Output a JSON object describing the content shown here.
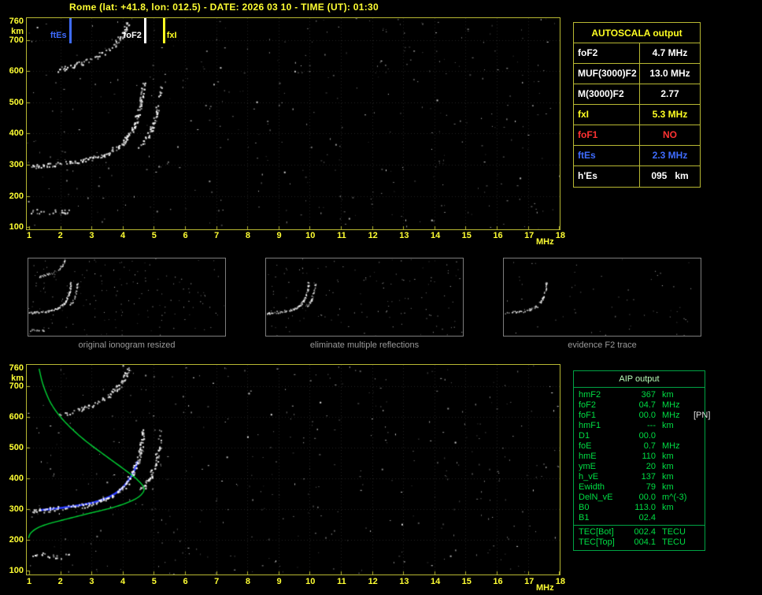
{
  "title": "Rome (lat: +41.8, lon: 012.5) - DATE: 2026 03 10 - TIME (UT): 01:30",
  "ionogram": {
    "y_labels": [
      "760",
      "700",
      "600",
      "500",
      "400",
      "300",
      "200",
      "100"
    ],
    "y_unit": "km",
    "x_labels": [
      "1",
      "2",
      "3",
      "4",
      "5",
      "6",
      "7",
      "8",
      "9",
      "10",
      "11",
      "12",
      "13",
      "14",
      "15",
      "16",
      "17",
      "18"
    ],
    "x_unit": "MHz",
    "legend": [
      {
        "label": "ftEs",
        "freq": 2.3,
        "color": "#3f6cff",
        "label_side": "left"
      },
      {
        "label": "foF2",
        "freq": 4.7,
        "color": "#ffffff",
        "label_side": "left"
      },
      {
        "label": "fxI",
        "freq": 5.3,
        "color": "#ffff22",
        "label_side": "right"
      }
    ]
  },
  "autoscala": {
    "title": "AUTOSCALA output",
    "rows": [
      {
        "label": "foF2",
        "value": "4.7 MHz",
        "color": "#ffffff"
      },
      {
        "label": "MUF(3000)F2",
        "value": "13.0 MHz",
        "color": "#ffffff"
      },
      {
        "label": "M(3000)F2",
        "value": "2.77",
        "color": "#ffffff"
      },
      {
        "label": "fxI",
        "value": "5.3 MHz",
        "color": "#ffff22"
      },
      {
        "label": "foF1",
        "value": "NO",
        "color": "#ff3232"
      },
      {
        "label": "ftEs",
        "value": "2.3 MHz",
        "color": "#3f6cff"
      },
      {
        "label": "h'Es",
        "value": "095   km",
        "color": "#ffffff"
      }
    ]
  },
  "thumbnails": [
    {
      "caption": "original ionogram resized"
    },
    {
      "caption": "eliminate multiple reflections"
    },
    {
      "caption": "evidence F2 trace"
    }
  ],
  "aip": {
    "title": "AIP output",
    "rows": [
      {
        "label": "hmF2",
        "value": "367",
        "unit": "km",
        "extra": ""
      },
      {
        "label": "foF2",
        "value": "04.7",
        "unit": "MHz",
        "extra": ""
      },
      {
        "label": "foF1",
        "value": "00.0",
        "unit": "MHz",
        "extra": "[PN]"
      },
      {
        "label": "hmF1",
        "value": "---",
        "unit": "km",
        "extra": ""
      },
      {
        "label": "D1",
        "value": "00.0",
        "unit": "",
        "extra": ""
      },
      {
        "label": "foE",
        "value": "0.7",
        "unit": "MHz",
        "extra": ""
      },
      {
        "label": "hmE",
        "value": "110",
        "unit": "km",
        "extra": ""
      },
      {
        "label": "ymE",
        "value": "20",
        "unit": "km",
        "extra": ""
      },
      {
        "label": "h_vE",
        "value": "137",
        "unit": "km",
        "extra": ""
      },
      {
        "label": "Ewidth",
        "value": "79",
        "unit": "km",
        "extra": ""
      },
      {
        "label": "DelN_vE",
        "value": "00.0",
        "unit": "m^(-3)",
        "extra": ""
      },
      {
        "label": "B0",
        "value": "113.0",
        "unit": "km",
        "extra": ""
      },
      {
        "label": "B1",
        "value": "02.4",
        "unit": "",
        "extra": ""
      }
    ],
    "tec_rows": [
      {
        "label": "TEC[Bot]",
        "value": "002.4",
        "unit": "TECU"
      },
      {
        "label": "TEC[Top]",
        "value": "004.1",
        "unit": "TECU"
      }
    ]
  },
  "colors": {
    "background": "#000000",
    "axis_yellow": "#ffff33",
    "plot_border": "#b8b832",
    "trace_white": "#ffffff",
    "profile_green": "#00d435",
    "restored_trace_blue": "#2a3cff",
    "aip_text_green": "#00dd44",
    "aip_border_green": "#00a344",
    "foF1_red": "#ff3232",
    "ftEs_blue": "#3f6cff"
  }
}
